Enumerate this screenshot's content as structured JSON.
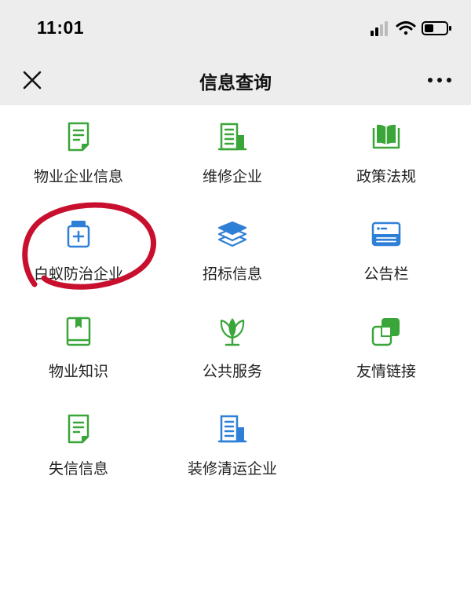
{
  "status": {
    "time": "11:01"
  },
  "nav": {
    "title": "信息查询"
  },
  "items": [
    {
      "label": "物业企业信息",
      "icon": "document-icon"
    },
    {
      "label": "维修企业",
      "icon": "building-icon"
    },
    {
      "label": "政策法规",
      "icon": "book-open-icon"
    },
    {
      "label": "白蚁防治企业",
      "icon": "medicine-jar-icon"
    },
    {
      "label": "招标信息",
      "icon": "layers-icon"
    },
    {
      "label": "公告栏",
      "icon": "card-icon"
    },
    {
      "label": "物业知识",
      "icon": "book-icon"
    },
    {
      "label": "公共服务",
      "icon": "leaf-icon"
    },
    {
      "label": "友情链接",
      "icon": "link-squares-icon"
    },
    {
      "label": "失信信息",
      "icon": "document-icon"
    },
    {
      "label": "装修清运企业",
      "icon": "building-icon"
    }
  ],
  "colors": {
    "green": "#3aa63a",
    "blue": "#2e7fd6",
    "annotation": "#c8102e"
  }
}
